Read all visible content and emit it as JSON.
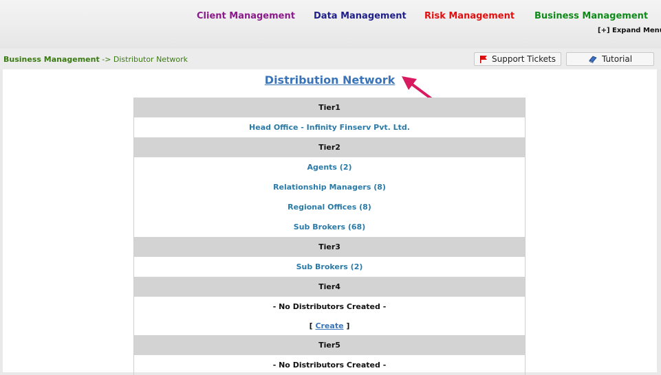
{
  "nav": {
    "client": "Client Management",
    "data": "Data Management",
    "risk": "Risk Management",
    "business": "Business Management",
    "expand": "[+] Expand Menu"
  },
  "breadcrumb": {
    "section": "Business Management",
    "separator": "->",
    "page": "Distributor Network"
  },
  "toolbar": {
    "support_label": "Support Tickets",
    "tutorial_label": "Tutorial"
  },
  "main": {
    "title": "Distribution Network"
  },
  "tiers": [
    {
      "name": "Tier1",
      "items": [
        "Head Office - Infinity Finserv Pvt. Ltd."
      ]
    },
    {
      "name": "Tier2",
      "items": [
        "Agents  (2)",
        "Relationship Managers  (8)",
        "Regional Offices  (8)",
        "Sub Brokers  (68)"
      ]
    },
    {
      "name": "Tier3",
      "items": [
        "Sub Brokers  (2)"
      ]
    },
    {
      "name": "Tier4",
      "empty_text": "- No Distributors Created -",
      "create_prefix": "[ ",
      "create_label": "Create",
      "create_suffix": " ]"
    },
    {
      "name": "Tier5",
      "empty_text": "- No Distributors Created -"
    }
  ],
  "colors": {
    "client": "#8b1a8b",
    "data": "#1f1f8a",
    "risk": "#e01010",
    "business": "#0f8a1a",
    "link": "#2a7aa8",
    "title": "#3a74b8",
    "arrow": "#d81b60",
    "tier_header_bg": "#d3d3d3"
  }
}
